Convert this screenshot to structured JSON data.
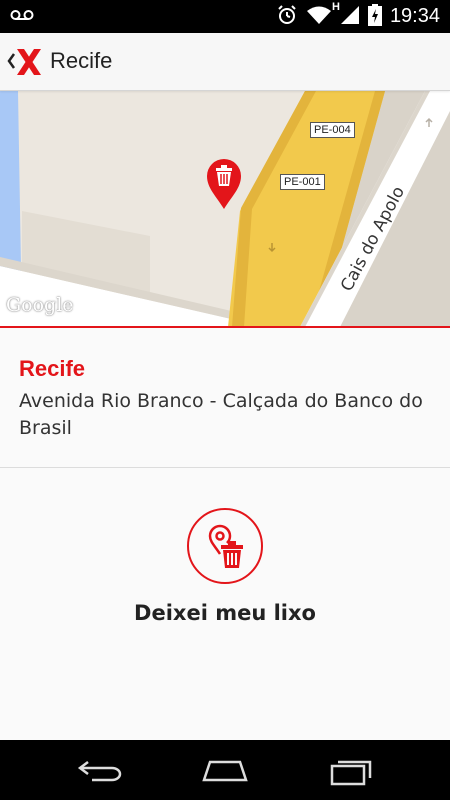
{
  "status_bar": {
    "time": "19:34",
    "network_type": "H",
    "icons": [
      "voicemail-icon",
      "alarm-icon",
      "wifi-icon",
      "signal-icon",
      "battery-charging-icon"
    ]
  },
  "action_bar": {
    "title": "Recife",
    "back_icon": "back-chevron-icon",
    "logo_icon": "app-logo-x-icon"
  },
  "map": {
    "road_labels": [
      "PE-004",
      "PE-001",
      "Cais do Apolo"
    ],
    "attribution": "Google",
    "marker_icon": "trash-marker-icon",
    "colors": {
      "highway": "#f2c94c",
      "water": "#a3c6f5",
      "land": "#ece7df",
      "marker": "#e3151a"
    }
  },
  "location": {
    "city": "Recife",
    "address": "Avenida Rio Branco - Calçada do Banco do Brasil"
  },
  "action": {
    "button_icon": "location-trash-icon",
    "label": "Deixei meu lixo"
  },
  "nav_bar": {
    "icons": [
      "back-icon",
      "home-icon",
      "recent-apps-icon"
    ]
  },
  "colors": {
    "accent": "#e3151a"
  }
}
